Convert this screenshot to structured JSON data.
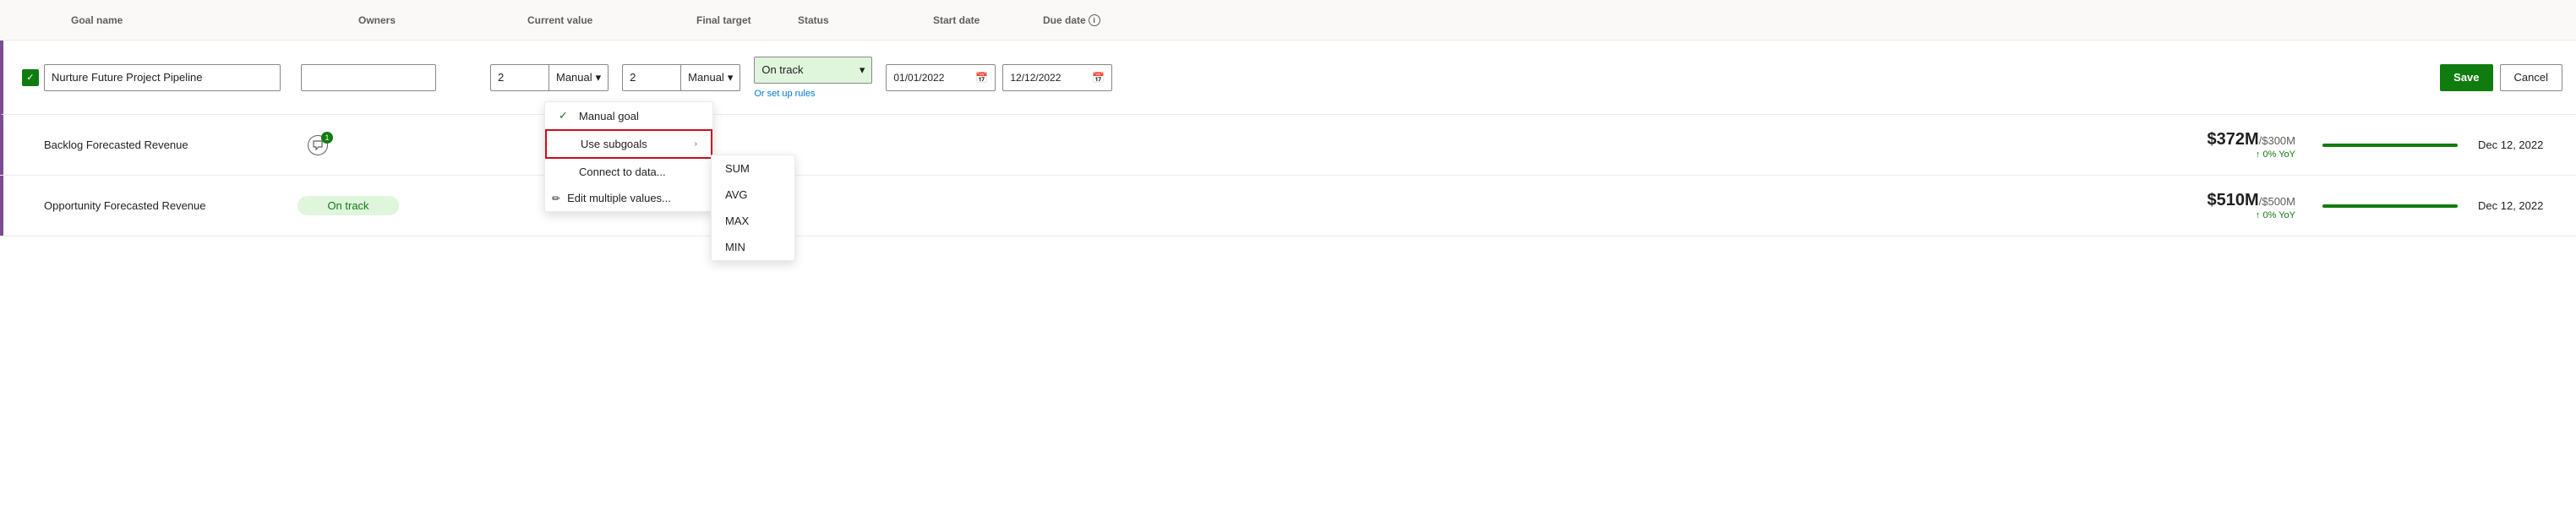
{
  "header": {
    "columns": {
      "goal_name": "Goal name",
      "owners": "Owners",
      "current_value": "Current value",
      "final_target": "Final target",
      "status": "Status",
      "start_date": "Start date",
      "due_date": "Due date"
    }
  },
  "edit_row": {
    "checkbox_checked": true,
    "goal_name_placeholder": "",
    "goal_name_value": "Nurture Future Project Pipeline",
    "owners_value": "",
    "current_value": "2",
    "current_method": "Manual",
    "final_target_value": "2",
    "final_target_method": "Manual",
    "status_value": "On track",
    "start_date": "01/01/2022",
    "due_date": "12/12/2022",
    "set_up_rules_label": "Or set up rules",
    "save_label": "Save",
    "cancel_label": "Cancel"
  },
  "dropdown_menu": {
    "items": [
      {
        "id": "manual-goal",
        "label": "Manual goal",
        "checked": true,
        "has_submenu": false,
        "highlighted": false
      },
      {
        "id": "use-subgoals",
        "label": "Use subgoals",
        "checked": false,
        "has_submenu": true,
        "highlighted": true
      },
      {
        "id": "connect-data",
        "label": "Connect to data...",
        "checked": false,
        "has_submenu": false,
        "highlighted": false
      },
      {
        "id": "edit-multiple",
        "label": "Edit multiple values...",
        "checked": false,
        "has_submenu": false,
        "highlighted": false
      }
    ],
    "submenu_items": [
      {
        "id": "sum",
        "label": "SUM"
      },
      {
        "id": "avg",
        "label": "AVG"
      },
      {
        "id": "max",
        "label": "MAX"
      },
      {
        "id": "min",
        "label": "MIN"
      }
    ]
  },
  "data_rows": [
    {
      "id": "row-1",
      "name": "Backlog Forecasted Revenue",
      "has_comment": true,
      "comment_count": "1",
      "status": "",
      "current_big": "$372M",
      "target": "/$300M",
      "yoy": "↑ 0% YoY",
      "progress_pct": 100,
      "due_date": "Dec 12, 2022"
    },
    {
      "id": "row-2",
      "name": "Opportunity Forecasted Revenue",
      "has_comment": false,
      "comment_count": "",
      "status": "On track",
      "current_big": "$510M",
      "target": "/$500M",
      "yoy": "↑ 0% YoY",
      "progress_pct": 100,
      "due_date": "Dec 12, 2022"
    }
  ],
  "icons": {
    "checkmark": "✓",
    "dropdown_arrow": "▾",
    "chevron_right": "›",
    "info": "i",
    "calendar": "📅",
    "pencil": "✏"
  }
}
